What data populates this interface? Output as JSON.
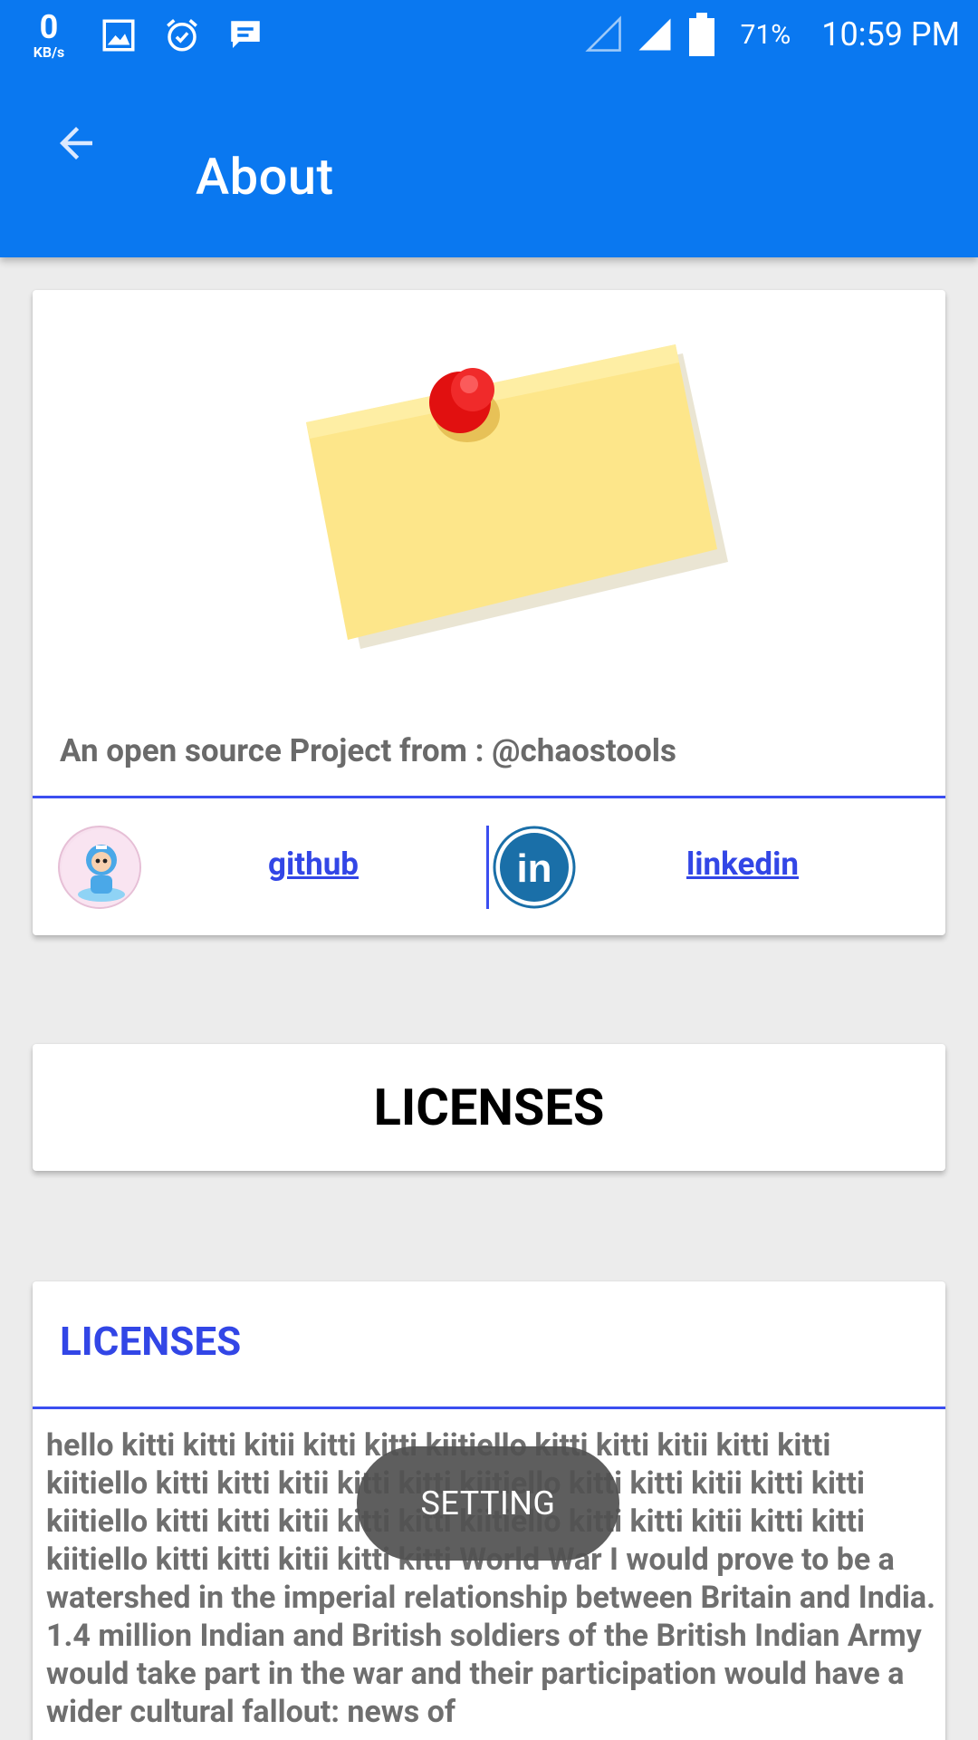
{
  "status_bar": {
    "net_speed_value": "0",
    "net_speed_unit": "KB/s",
    "icons": [
      "gallery-icon",
      "alarm-icon",
      "message-icon",
      "signal-empty-icon",
      "signal-full-icon",
      "battery-icon"
    ],
    "battery_percent": "71%",
    "time": "10:59 PM"
  },
  "app_bar": {
    "title": "About",
    "back_icon": "arrow-back-icon",
    "color": "#0a78f0"
  },
  "about_card": {
    "image_icon": "sticky-note-pin-icon",
    "tagline": "An open source Project from : @chaostools",
    "github_label": "github",
    "linkedin_label": "linkedin",
    "avatar_icon": "avatar-icon",
    "linkedin_icon": "linkedin-icon",
    "accent": "#3b4ef0"
  },
  "licenses_button": {
    "label": "LICENSES"
  },
  "licenses_card": {
    "header": "LICENSES",
    "body": "hello kitti kitti kitii kitti kitti kiitiello kitti kitti kitii kitti kitti kiitiello kitti kitti kitii kitti kitti kiitiello kitti kitti kitii kitti kitti kiitiello kitti kitti kitii kitti kitti kiitiello kitti kitti kitii kitti kitti kiitiello kitti kitti kitii kitti kitti World War I would prove to be a watershed in the imperial relationship between Britain and India. 1.4 million Indian and British soldiers of the British Indian Army would take part in the war and their participation would have a wider cultural fallout: news of"
  },
  "toast": {
    "text": "SETTING"
  }
}
